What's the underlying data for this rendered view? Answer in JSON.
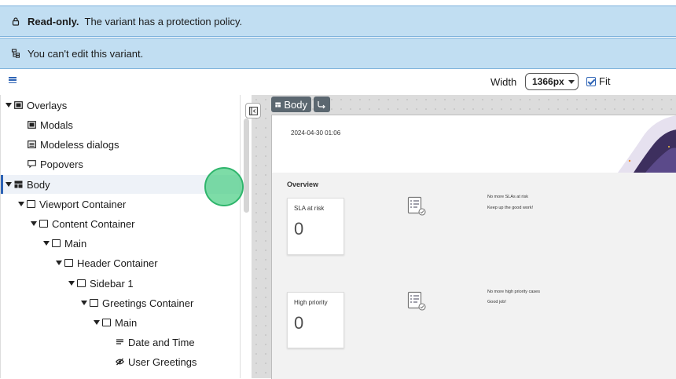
{
  "banner_readonly": {
    "bold": "Read-only.",
    "text": "The variant has a protection policy.",
    "icon": "lock-icon"
  },
  "banner_noedit": {
    "text": "You can't edit this variant.",
    "icon": "hierarchy-icon"
  },
  "toolbar": {
    "width_label": "Width",
    "width_value": "1366px",
    "fit_label": "Fit",
    "fit_checked": true
  },
  "tree": {
    "items": [
      {
        "label": "Overlays",
        "icon": "overlay-icon",
        "expanded": true,
        "depth": 0
      },
      {
        "label": "Modals",
        "icon": "modal-icon",
        "depth": 1
      },
      {
        "label": "Modeless dialogs",
        "icon": "modeless-dialog-icon",
        "depth": 1
      },
      {
        "label": "Popovers",
        "icon": "popover-icon",
        "depth": 1
      },
      {
        "label": "Body",
        "icon": "body-layout-icon",
        "expanded": true,
        "selected": true,
        "depth": 0
      },
      {
        "label": "Viewport Container",
        "icon": "container-icon",
        "expanded": true,
        "depth": 1
      },
      {
        "label": "Content Container",
        "icon": "container-icon",
        "expanded": true,
        "depth": 2
      },
      {
        "label": "Main",
        "icon": "container-icon",
        "expanded": true,
        "depth": 3
      },
      {
        "label": "Header Container",
        "icon": "container-icon",
        "expanded": true,
        "depth": 4
      },
      {
        "label": "Sidebar 1",
        "icon": "container-icon",
        "expanded": true,
        "depth": 5
      },
      {
        "label": "Greetings Container",
        "icon": "container-icon",
        "expanded": true,
        "depth": 6
      },
      {
        "label": "Main",
        "icon": "container-icon",
        "expanded": true,
        "depth": 7
      },
      {
        "label": "Date and Time",
        "icon": "text-lines-icon",
        "depth": 8
      },
      {
        "label": "User Greetings",
        "icon": "hidden-eye-icon",
        "depth": 8
      }
    ]
  },
  "canvas": {
    "tag_body": "Body",
    "tag_parent_icon": "select-parent-icon",
    "date": "2024-04-30 01:06",
    "overview_title": "Overview",
    "cards": [
      {
        "label": "SLA at risk",
        "value": "0",
        "msg_title": "No more SLAs at risk",
        "msg_sub": "Keep up the good work!"
      },
      {
        "label": "High priority",
        "value": "0",
        "msg_title": "No more high priority cases",
        "msg_sub": "Good job!"
      }
    ]
  },
  "colors": {
    "banner_bg": "#c1def2",
    "accent": "#2d63b5",
    "tag_bg": "#5b6770",
    "touch_indicator": "#46cd82"
  }
}
